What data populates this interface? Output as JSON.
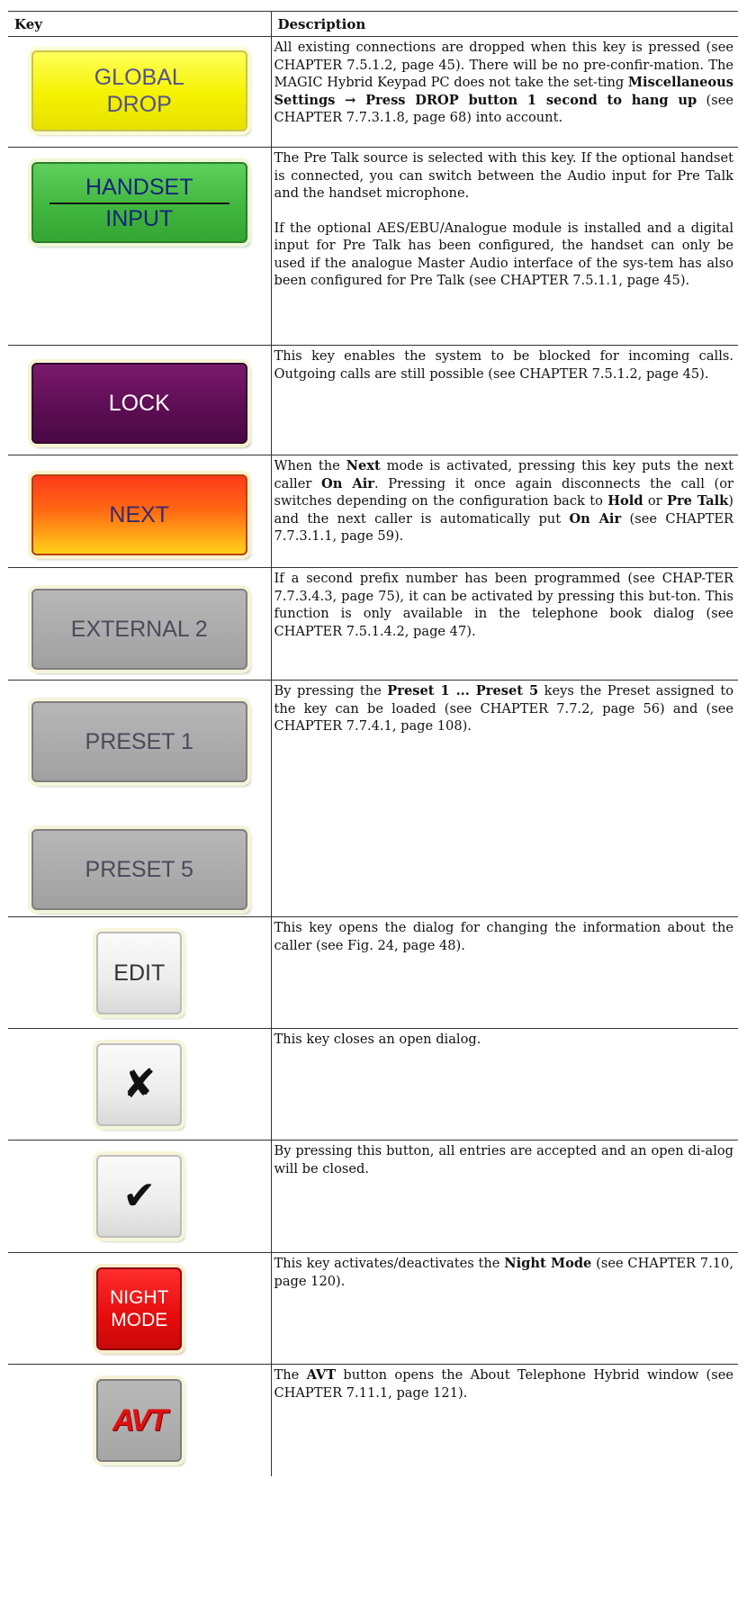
{
  "header": {
    "key": "Key",
    "description": "Description"
  },
  "rows": [
    {
      "key_lines": [
        "GLOBAL",
        "DROP"
      ],
      "desc": [
        [
          "All existing connections are dropped when this key is pressed (see CHAPTER 7.5.1.2, page 45). There will be no pre-confir-mation. The MAGIC Hybrid Keypad PC does not take the set-ting ",
          "Miscellaneous Settings → Press DROP button 1 second to hang up",
          " (see CHAPTER 7.7.3.1.8, page 68) into account."
        ]
      ]
    },
    {
      "key_lines": [
        "HANDSET",
        "INPUT"
      ],
      "desc": [
        "The Pre Talk source is selected with this key. If the optional handset is connected, you can switch between the Audio input for Pre Talk and the handset microphone.",
        "If the optional AES/EBU/Analogue module is installed and a digital input for Pre Talk has been configured, the handset can only be used if the analogue Master Audio interface of the sys-tem has also been configured for Pre Talk (see CHAPTER 7.5.1.1, page 45)."
      ]
    },
    {
      "key_label": "LOCK",
      "desc": "This key enables the system to be blocked for incoming calls. Outgoing calls are still possible (see CHAPTER 7.5.1.2, page 45)."
    },
    {
      "key_label": "NEXT",
      "desc_parts": [
        "When the ",
        "Next",
        " mode is activated, pressing this key puts the next caller ",
        "On Air",
        ". Pressing it once again disconnects the call (or switches depending on the configuration back to ",
        "Hold",
        " or ",
        "Pre Talk",
        ") and the next caller is automatically put ",
        "On Air",
        " (see CHAPTER 7.7.3.1.1, page 59)."
      ]
    },
    {
      "key_label": "EXTERNAL 2",
      "desc": "If a second prefix number has been programmed (see CHAP-TER 7.7.3.4.3, page 75), it can be activated by pressing this but-ton. This function is only available in the telephone book dialog (see CHAPTER 7.5.1.4.2, page 47)."
    },
    {
      "key_labels": [
        "PRESET 1",
        "PRESET 5"
      ],
      "desc_parts": [
        "By pressing the ",
        "Preset 1 ... Preset 5",
        " keys the Preset assigned to the key can be loaded (see CHAPTER 7.7.2, page 56) and (see CHAPTER 7.7.4.1, page 108)."
      ]
    },
    {
      "key_label": "EDIT",
      "desc": "This key opens the dialog for changing the information about the caller (see Fig. 24, page 48)."
    },
    {
      "key_icon": "close-x-icon",
      "key_glyph": "✘",
      "desc": "This key closes an open dialog."
    },
    {
      "key_icon": "checkmark-icon",
      "key_glyph": "✔",
      "desc": "By pressing this button, all entries are accepted and an open di-alog will be closed."
    },
    {
      "key_lines": [
        "NIGHT",
        "MODE"
      ],
      "desc_parts": [
        "This key activates/deactivates the ",
        "Night Mode",
        " (see CHAPTER 7.10, page 120)."
      ]
    },
    {
      "key_label": "AVT",
      "desc_parts": [
        "The ",
        "AVT",
        " button opens the About Telephone Hybrid window (see CHAPTER 7.11.1, page 121)."
      ]
    }
  ]
}
